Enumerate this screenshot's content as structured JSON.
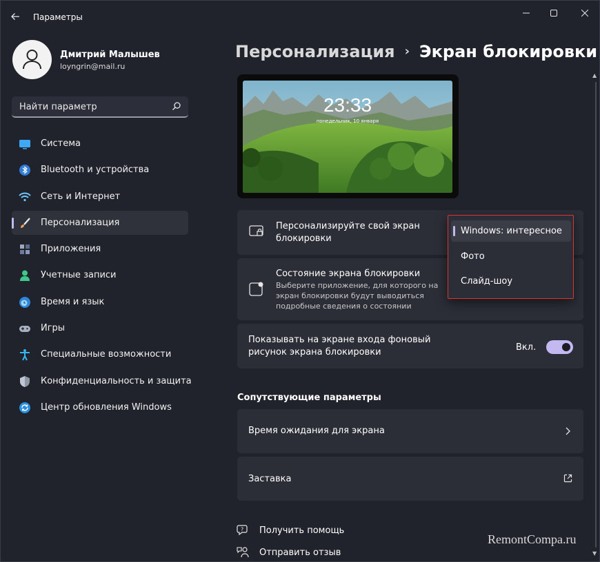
{
  "window": {
    "title": "Параметры"
  },
  "profile": {
    "name": "Дмитрий Малышев",
    "email": "loyngrin@mail.ru"
  },
  "search": {
    "placeholder": "Найти параметр"
  },
  "sidebar": {
    "items": [
      {
        "label": "Система",
        "icon": "system-icon",
        "active": false
      },
      {
        "label": "Bluetooth и устройства",
        "icon": "bluetooth-icon",
        "active": false
      },
      {
        "label": "Сеть и Интернет",
        "icon": "wifi-icon",
        "active": false
      },
      {
        "label": "Персонализация",
        "icon": "brush-icon",
        "active": true
      },
      {
        "label": "Приложения",
        "icon": "apps-icon",
        "active": false
      },
      {
        "label": "Учетные записи",
        "icon": "account-icon",
        "active": false
      },
      {
        "label": "Время и язык",
        "icon": "time-language-icon",
        "active": false
      },
      {
        "label": "Игры",
        "icon": "gamepad-icon",
        "active": false
      },
      {
        "label": "Специальные возможности",
        "icon": "accessibility-icon",
        "active": false
      },
      {
        "label": "Конфиденциальность и защита",
        "icon": "shield-icon",
        "active": false
      },
      {
        "label": "Центр обновления Windows",
        "icon": "update-icon",
        "active": false
      }
    ]
  },
  "header": {
    "breadcrumb": "Персонализация",
    "separator": "›",
    "title": "Экран блокировки"
  },
  "preview": {
    "time": "23:33",
    "date": "понедельник, 10 января"
  },
  "cards": {
    "personalize": {
      "title": "Персонализируйте свой экран блокировки"
    },
    "status": {
      "title": "Состояние экрана блокировки",
      "description": "Выберите приложение, для которого на экран блокировки будут выводиться подробные сведения о состоянии"
    },
    "signin": {
      "title": "Показывать на экране входа фоновый рисунок экрана блокировки",
      "toggle_label": "Вкл.",
      "toggle_on": true
    }
  },
  "dropdown": {
    "options": [
      "Windows: интересное",
      "Фото",
      "Слайд-шоу"
    ],
    "selected_index": 0
  },
  "related": {
    "heading": "Сопутствующие параметры",
    "items": [
      {
        "label": "Время ожидания для экрана",
        "icon": "chevron-right-icon"
      },
      {
        "label": "Заставка",
        "icon": "external-link-icon"
      }
    ]
  },
  "help": {
    "get_help": "Получить помощь",
    "feedback": "Отправить отзыв"
  },
  "watermark": "RemontCompa.ru",
  "colors": {
    "accent": "#c3b8f0",
    "highlight_border": "#e0342c",
    "card_bg": "#2b2e37",
    "window_bg": "#20232c"
  }
}
